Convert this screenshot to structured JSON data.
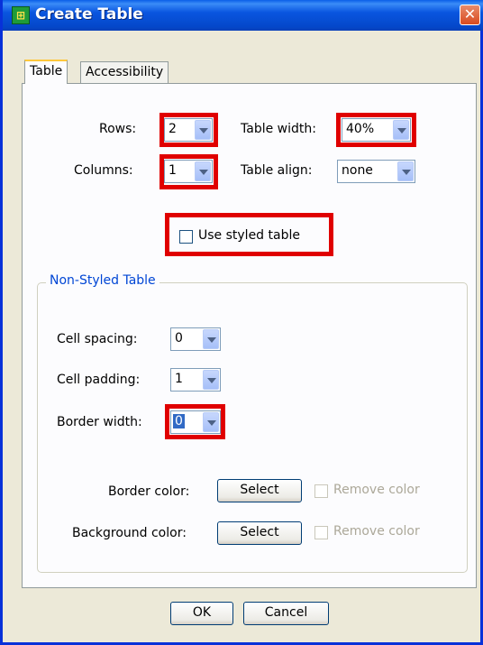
{
  "window": {
    "title": "Create Table",
    "close_label": "✕",
    "app_icon_glyph": "⊞"
  },
  "tabs": [
    {
      "label": "Table",
      "active": true
    },
    {
      "label": "Accessibility",
      "active": false
    }
  ],
  "table": {
    "rows_label": "Rows:",
    "rows_value": "2",
    "columns_label": "Columns:",
    "columns_value": "1",
    "width_label": "Table width:",
    "width_value": "40%",
    "align_label": "Table align:",
    "align_value": "none",
    "styled_label": "Use styled table"
  },
  "non_styled": {
    "legend": "Non-Styled Table",
    "spacing_label": "Cell spacing:",
    "spacing_value": "0",
    "padding_label": "Cell padding:",
    "padding_value": "1",
    "border_width_label": "Border width:",
    "border_width_value": "0",
    "border_color_label": "Border color:",
    "background_color_label": "Background color:",
    "select_label": "Select",
    "remove_color_label": "Remove color"
  },
  "buttons": {
    "ok": "OK",
    "cancel": "Cancel"
  },
  "colors": {
    "highlight": "#e00000",
    "accent": "#0046d5",
    "title_bar": "#0a56e0"
  }
}
